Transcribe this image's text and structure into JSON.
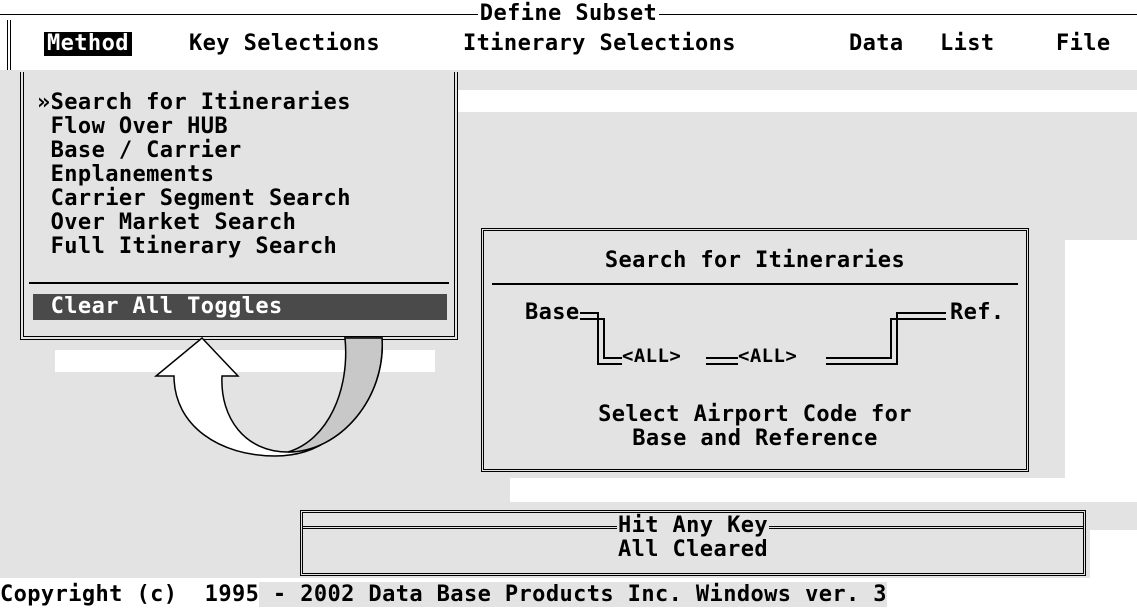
{
  "window": {
    "title": "Define Subset"
  },
  "menubar": {
    "items": [
      "Method",
      "Key Selections",
      "Itinerary Selections",
      "Data",
      "List",
      "File"
    ],
    "active": "Method"
  },
  "method_menu": {
    "items": [
      "»Search for Itineraries",
      " Flow Over HUB",
      " Base / Carrier",
      " Enplanements",
      " Carrier Segment Search",
      " Over Market Search",
      " Full Itinerary Search"
    ],
    "selected_item": "Search for Itineraries",
    "clear_label": " Clear All Toggles"
  },
  "search_dialog": {
    "title": "Search for Itineraries",
    "base_label": "Base",
    "ref_label": "Ref.",
    "base_value": "<ALL>",
    "ref_value": "<ALL>",
    "message_line1": "Select Airport Code for",
    "message_line2": "Base and Reference"
  },
  "key_box": {
    "title": "Hit Any Key",
    "message": "All Cleared"
  },
  "footer": {
    "copyright_a": "Copyright (c)  1995",
    "copyright_b": " - 2002 Data Base Products Inc. Windows ver. 3"
  },
  "icons": {
    "curved-arrow": "curved-arrow-icon"
  },
  "colors": {
    "background": "#e3e3e3",
    "highlight": "#4a4a4a",
    "text": "#000000"
  }
}
